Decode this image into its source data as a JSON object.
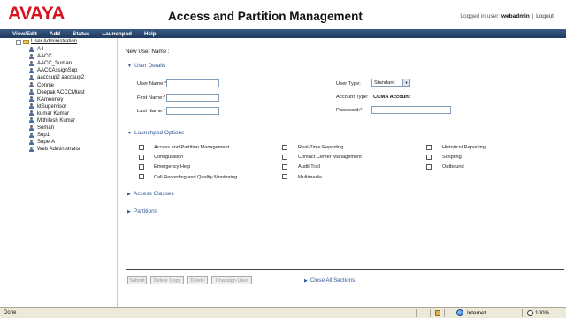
{
  "header": {
    "logo": "AVAYA",
    "title": "Access and Partition Management",
    "logged_in_prefix": "Logged in user:",
    "username": "webadmin",
    "separator": "|",
    "logout": "Logout"
  },
  "menu": [
    "View/Edit",
    "Add",
    "Status",
    "Launchpad",
    "Help"
  ],
  "tree": {
    "root_label": "User Administration",
    "expander": "−",
    "items": [
      "A4",
      "AACC",
      "AACC_Suman",
      "AACCAssignSup",
      "aaccsup2 aaccsup2",
      "Connie",
      "Deepak ACCCMtest",
      "KAmeeney",
      "ktSupervisor",
      "kumar Kumar",
      "Mithilesh Kumar",
      "Soman",
      "Sup1",
      "SuperA",
      "Web Administrator"
    ]
  },
  "form": {
    "heading": "New User Name :",
    "user_details": {
      "toggle": "User Details",
      "first_name_label": "User Name:",
      "first_name_value": "",
      "middle_label": "First Name:",
      "middle_value": "",
      "last_label": "Last Name:",
      "last_value": "",
      "user_type_label": "User Type:",
      "user_type_value": "Standard",
      "account_type_label": "Account Type:",
      "account_type_value": "CCMA Account",
      "password_label": "Password:",
      "password_value": "",
      "required_marks": [
        "*",
        "*",
        "*",
        "*"
      ]
    },
    "launchpad": {
      "toggle": "Launchpad Options",
      "col1": [
        "Access and Partition Management",
        "Configuration",
        "Emergency Help",
        "Call Recording and Quality Monitoring"
      ],
      "col2": [
        "Real-Time Reporting",
        "Contact Center Management",
        "Audit Trail",
        "Multimedia"
      ],
      "col3": [
        "Historical Reporting",
        "Scripting",
        "Outbound"
      ]
    },
    "access_classes": "Access Classes",
    "partitions": "Partitions"
  },
  "buttons": {
    "submit": "Submit",
    "delete_copy": "Delete Copy",
    "delete": "Delete",
    "unassign_user": "Unassign User",
    "close_all": "Close All Sections"
  },
  "statusbar": {
    "status": "Done",
    "zone": "Internet",
    "zoom": "100%"
  }
}
